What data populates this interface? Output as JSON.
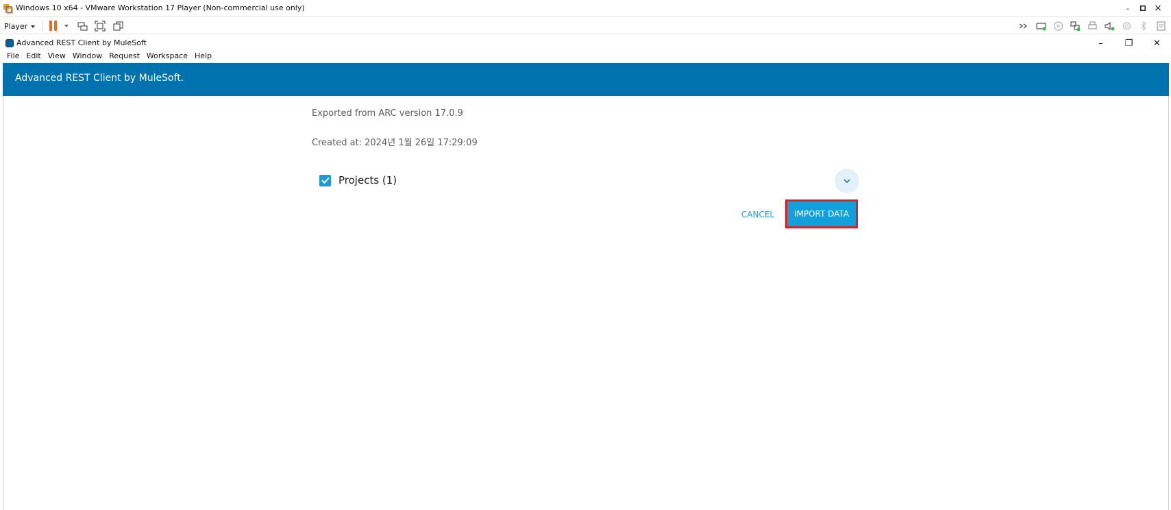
{
  "vm": {
    "title": "Windows 10 x64 - VMware Workstation 17 Player (Non-commercial use only)",
    "player_label": "Player",
    "controls": {
      "minimize": "–",
      "maximize": "▫",
      "close": "×"
    }
  },
  "app": {
    "title": "Advanced REST Client by MuleSoft",
    "controls": {
      "minimize": "–",
      "restore": "❐",
      "close": "✕"
    },
    "menu": [
      "File",
      "Edit",
      "View",
      "Window",
      "Request",
      "Workspace",
      "Help"
    ],
    "header_title": "Advanced REST Client by MuleSoft."
  },
  "import": {
    "exported_from": "Exported from ARC version 17.0.9",
    "created_at": "Created at: 2024년 1월 26일 17:29:09",
    "projects_label": "Projects (1)",
    "projects_checked": true,
    "cancel_label": "CANCEL",
    "import_label": "IMPORT DATA"
  },
  "colors": {
    "header_bg": "#0073ae",
    "accent": "#11a0dc",
    "highlight_border": "#e02020",
    "pause_orange": "#ef6a1a"
  }
}
